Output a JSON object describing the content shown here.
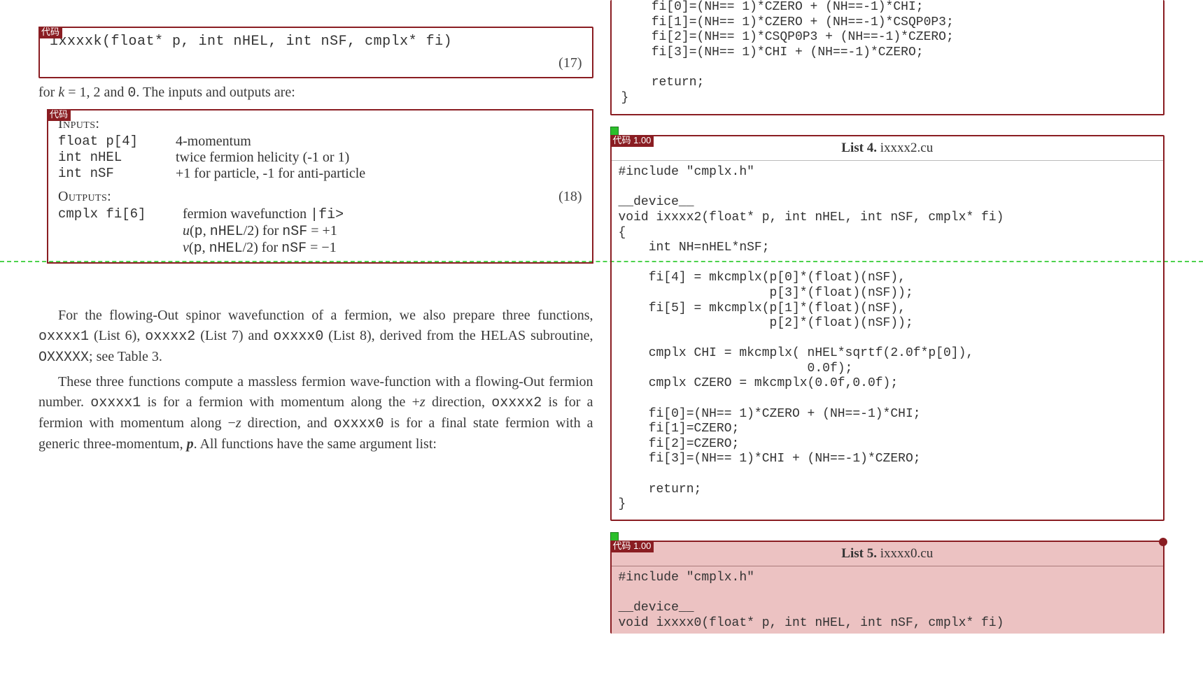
{
  "tags": {
    "code": "代码",
    "code_score": "代码 1.00"
  },
  "left": {
    "eq17": {
      "sig": "ixxxxk(float* p, int nHEL, int nSF, cmplx* fi)",
      "num": "(17)"
    },
    "aftereq17": "for k = 1, 2 and 0. The inputs and outputs are:",
    "inputs_label": "Inputs:",
    "in1_a": "float p[4]",
    "in1_b": "4-momentum",
    "in2_a": "int nHEL",
    "in2_b": "twice fermion helicity (-1 or 1)",
    "in3_a": "int nSF",
    "in3_b": "+1 for particle, -1 for anti-particle",
    "outputs_label": "Outputs:",
    "eq18num": "(18)",
    "out1_a": "cmplx fi[6]",
    "out1_b": "fermion wavefunction |fi>",
    "out2_b": "u(p, nHEL/2) for nSF = +1",
    "out3_b": "v(p, nHEL/2) for nSF = −1",
    "p1": "For the flowing-Out spinor wavefunction of a fermion, we also prepare three functions, oxxxx1 (List 6), oxxxx2 (List 7) and oxxxx0 (List 8), derived from the HELAS subroutine, OXXXXX; see Table 3.",
    "p2": "These three functions compute a massless fermion wave-function with a flowing-Out fermion number. oxxxx1 is for a fermion with momentum along the +z direction, oxxxx2 is for a fermion with momentum along −z direction, and oxxxx0 is for a final state fermion with a generic three-momentum, p. All functions have the same argument list:"
  },
  "right": {
    "topcode": "    fi[0]=(NH== 1)*CZERO + (NH==-1)*CHI;\n    fi[1]=(NH== 1)*CZERO + (NH==-1)*CSQP0P3;\n    fi[2]=(NH== 1)*CSQP0P3 + (NH==-1)*CZERO;\n    fi[3]=(NH== 1)*CHI + (NH==-1)*CZERO;\n\n    return;\n}",
    "list4": {
      "label_bold": "List 4.",
      "label_file": " ixxxx2.cu",
      "code": "#include \"cmplx.h\"\n\n__device__\nvoid ixxxx2(float* p, int nHEL, int nSF, cmplx* fi)\n{\n    int NH=nHEL*nSF;\n\n    fi[4] = mkcmplx(p[0]*(float)(nSF),\n                    p[3]*(float)(nSF));\n    fi[5] = mkcmplx(p[1]*(float)(nSF),\n                    p[2]*(float)(nSF));\n\n    cmplx CHI = mkcmplx( nHEL*sqrtf(2.0f*p[0]),\n                         0.0f);\n    cmplx CZERO = mkcmplx(0.0f,0.0f);\n\n    fi[0]=(NH== 1)*CZERO + (NH==-1)*CHI;\n    fi[1]=CZERO;\n    fi[2]=CZERO;\n    fi[3]=(NH== 1)*CHI + (NH==-1)*CZERO;\n\n    return;\n}"
    },
    "list5": {
      "label_bold": "List 5.",
      "label_file": " ixxxx0.cu",
      "code": "#include \"cmplx.h\"\n\n__device__\nvoid ixxxx0(float* p, int nHEL, int nSF, cmplx* fi)"
    }
  }
}
